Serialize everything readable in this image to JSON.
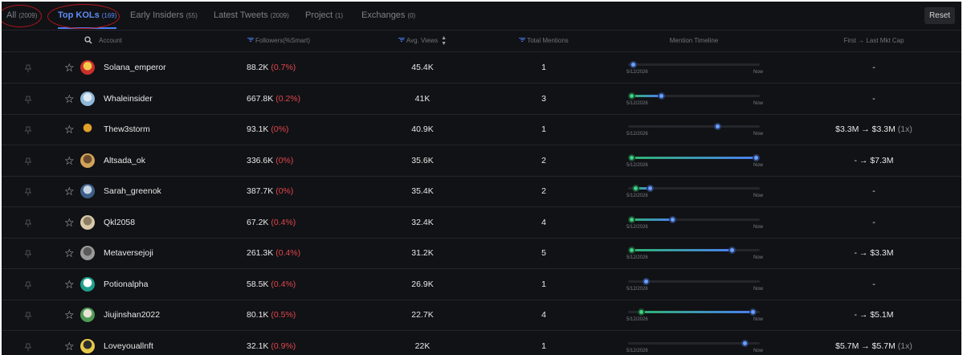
{
  "tabs": [
    {
      "label": "All",
      "count": "(2009)",
      "active": false
    },
    {
      "label": "Top KOLs",
      "count": "(169)",
      "active": true
    },
    {
      "label": "Early Insiders",
      "count": "(55)",
      "active": false
    },
    {
      "label": "Latest Tweets",
      "count": "(2009)",
      "active": false
    },
    {
      "label": "Project",
      "count": "(1)",
      "active": false
    },
    {
      "label": "Exchanges",
      "count": "(0)",
      "active": false
    }
  ],
  "reset_label": "Reset",
  "columns": {
    "account": "Account",
    "followers": "Followers(%Smart)",
    "avg_views": "Avg. Views",
    "total_mentions": "Total Mentions",
    "timeline": "Mention Timeline",
    "mktcap": "First → Last Mkt Cap"
  },
  "timeline_start": "5/12/2026",
  "timeline_end": "Now",
  "rows": [
    {
      "name": "Solana_emperor",
      "followers": "88.2K",
      "smart": "(0.7%)",
      "views": "45.4K",
      "mentions": "1",
      "mcap": {
        "text": "-"
      },
      "avatar_colors": [
        "#c9302c",
        "#f2c94c"
      ],
      "timeline": {
        "first": 0.04,
        "last": null
      }
    },
    {
      "name": "Whaleinsider",
      "followers": "667.8K",
      "smart": "(0.2%)",
      "views": "41K",
      "mentions": "3",
      "mcap": {
        "text": "-"
      },
      "avatar_colors": [
        "#8fb7d8",
        "#dfe9f2"
      ],
      "timeline": {
        "first": 0.03,
        "last": 0.25
      }
    },
    {
      "name": "Thew3storm",
      "followers": "93.1K",
      "smart": "(0%)",
      "views": "40.9K",
      "mentions": "1",
      "mcap": {
        "first": "$3.3M",
        "last": "$3.3M",
        "mult": "(1x)"
      },
      "avatar_colors": [
        "#111215",
        "#e2a12b"
      ],
      "timeline": {
        "first": 0.68,
        "last": null
      }
    },
    {
      "name": "Altsada_ok",
      "followers": "336.6K",
      "smart": "(0%)",
      "views": "35.6K",
      "mentions": "2",
      "mcap": {
        "first": "-",
        "last": "$7.3M"
      },
      "avatar_colors": [
        "#d1a35a",
        "#6a4a2a"
      ],
      "timeline": {
        "first": 0.03,
        "last": 0.97
      }
    },
    {
      "name": "Sarah_greenok",
      "followers": "387.7K",
      "smart": "(0%)",
      "views": "35.4K",
      "mentions": "2",
      "mcap": {
        "text": "-"
      },
      "avatar_colors": [
        "#3c5f86",
        "#c7d4e4"
      ],
      "timeline": {
        "first": 0.06,
        "last": 0.17
      }
    },
    {
      "name": "Qkl2058",
      "followers": "67.2K",
      "smart": "(0.4%)",
      "views": "32.4K",
      "mentions": "4",
      "mcap": {
        "text": "-"
      },
      "avatar_colors": [
        "#d8c9a8",
        "#8a7d63"
      ],
      "timeline": {
        "first": 0.03,
        "last": 0.34
      }
    },
    {
      "name": "Metaversejoji",
      "followers": "261.3K",
      "smart": "(0.4%)",
      "views": "31.2K",
      "mentions": "5",
      "mcap": {
        "first": "-",
        "last": "$3.3M"
      },
      "avatar_colors": [
        "#9a9a9a",
        "#5a5a5a"
      ],
      "timeline": {
        "first": 0.03,
        "last": 0.79
      }
    },
    {
      "name": "Potionalpha",
      "followers": "58.5K",
      "smart": "(0.4%)",
      "views": "26.9K",
      "mentions": "1",
      "mcap": {
        "text": "-"
      },
      "avatar_colors": [
        "#1f9e8c",
        "#ffffff"
      ],
      "timeline": {
        "first": 0.14,
        "last": null
      }
    },
    {
      "name": "Jiujinshan2022",
      "followers": "80.1K",
      "smart": "(0.5%)",
      "views": "22.7K",
      "mentions": "4",
      "mcap": {
        "first": "-",
        "last": "$5.1M"
      },
      "avatar_colors": [
        "#4f9a57",
        "#e7e3d5"
      ],
      "timeline": {
        "first": 0.1,
        "last": 0.95
      }
    },
    {
      "name": "Loveyouallnft",
      "followers": "32.1K",
      "smart": "(0.9%)",
      "views": "22K",
      "mentions": "1",
      "mcap": {
        "first": "$5.7M",
        "last": "$5.7M",
        "mult": "(1x)"
      },
      "avatar_colors": [
        "#e7c94a",
        "#2d2d2d"
      ],
      "timeline": {
        "first": 0.89,
        "last": null
      }
    }
  ]
}
